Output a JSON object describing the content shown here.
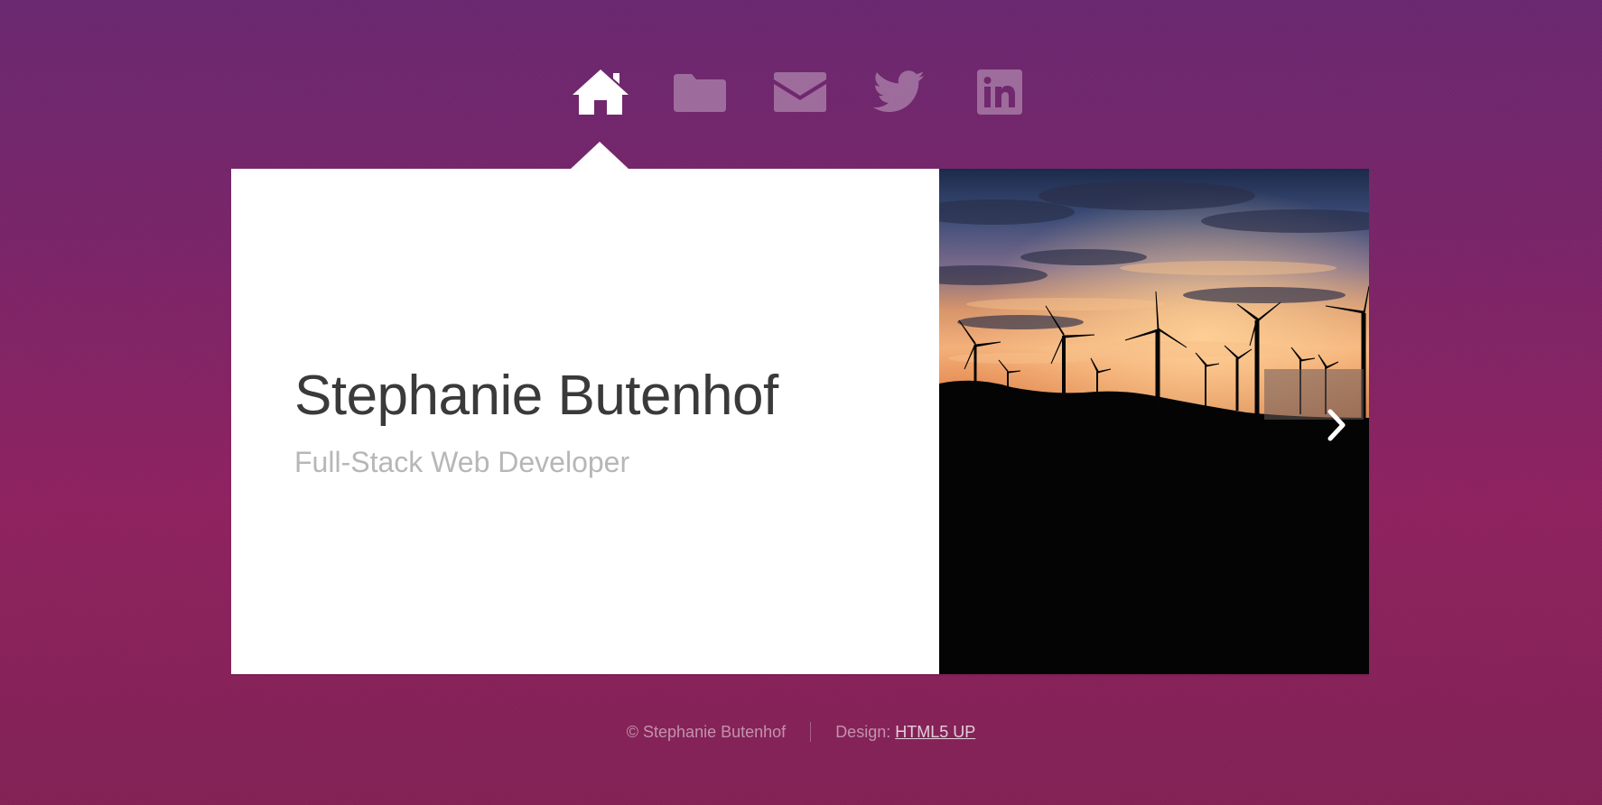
{
  "nav": {
    "items": [
      {
        "icon": "home-icon",
        "active": true
      },
      {
        "icon": "folder-icon",
        "active": false
      },
      {
        "icon": "envelope-icon",
        "active": false
      },
      {
        "icon": "twitter-icon",
        "active": false
      },
      {
        "icon": "linkedin-icon",
        "active": false
      }
    ]
  },
  "intro": {
    "name": "Stephanie Butenhof",
    "role": "Full-Stack Web Developer"
  },
  "photo": {
    "next_icon": "chevron-right-icon"
  },
  "footer": {
    "copyright": "© Stephanie Butenhof",
    "design_label": "Design:",
    "design_link": "HTML5 UP"
  },
  "colors": {
    "background_top": "#6a2870",
    "background_bottom": "#8f2260",
    "panel": "#ffffff",
    "name_text": "#3a3a3a",
    "role_text": "#b7b7b7"
  }
}
